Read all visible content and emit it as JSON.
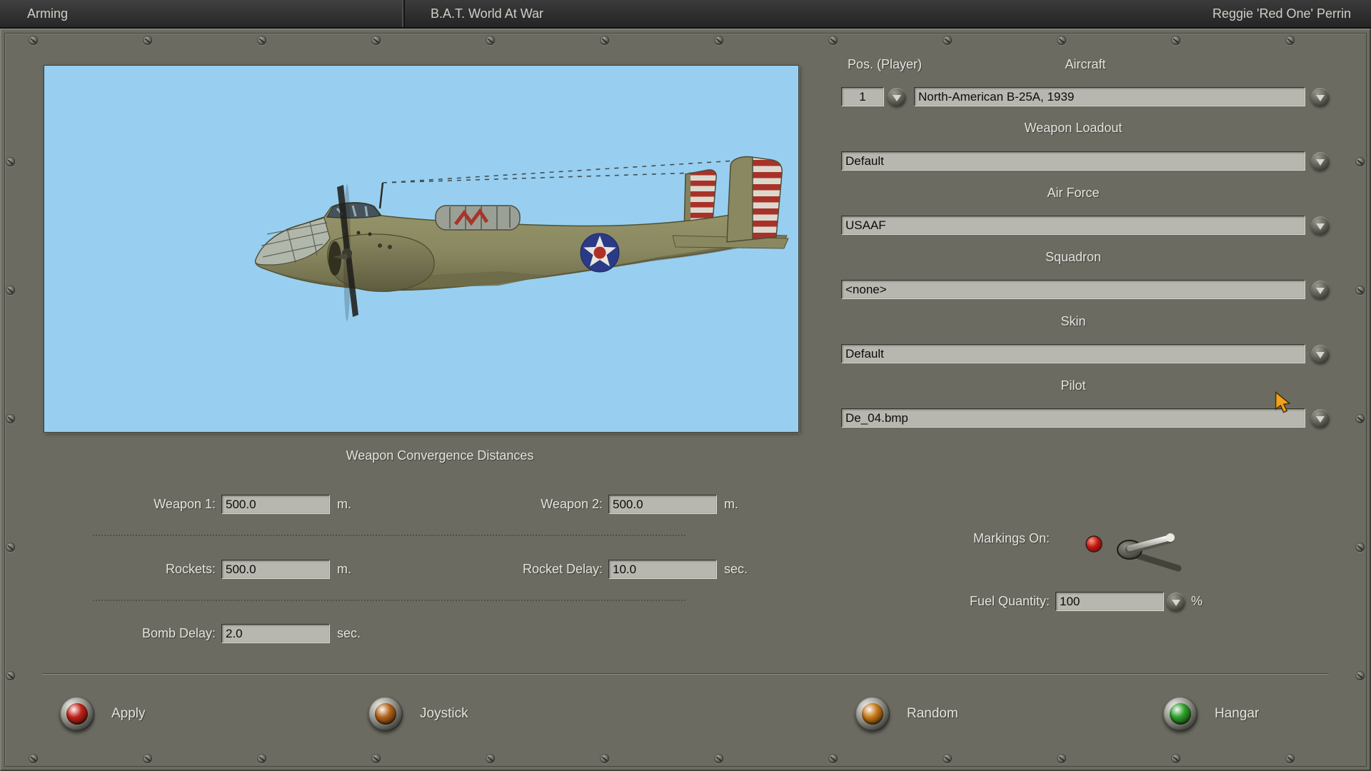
{
  "topbar": {
    "tab": "Arming",
    "title": "B.A.T. World At War",
    "player": "Reggie 'Red One' Perrin"
  },
  "form": {
    "pos": {
      "label": "Pos. (Player)",
      "value": "1"
    },
    "aircraft": {
      "label": "Aircraft",
      "value": "North-American B-25A, 1939"
    },
    "loadout": {
      "label": "Weapon Loadout",
      "value": "Default"
    },
    "airforce": {
      "label": "Air Force",
      "value": "USAAF"
    },
    "squadron": {
      "label": "Squadron",
      "value": "<none>"
    },
    "skin": {
      "label": "Skin",
      "value": "Default"
    },
    "pilot": {
      "label": "Pilot",
      "value": "De_04.bmp"
    }
  },
  "convergence": {
    "title": "Weapon Convergence Distances",
    "weapon1": {
      "label": "Weapon 1:",
      "value": "500.0",
      "unit": "m."
    },
    "weapon2": {
      "label": "Weapon 2:",
      "value": "500.0",
      "unit": "m."
    },
    "rockets": {
      "label": "Rockets:",
      "value": "500.0",
      "unit": "m."
    },
    "rocket_delay": {
      "label": "Rocket Delay:",
      "value": "10.0",
      "unit": "sec."
    },
    "bomb_delay": {
      "label": "Bomb Delay:",
      "value": "2.0",
      "unit": "sec."
    }
  },
  "markings": {
    "label": "Markings On:",
    "state": "on"
  },
  "fuel": {
    "label": "Fuel Quantity:",
    "value": "100",
    "unit": "%"
  },
  "actions": {
    "apply": {
      "label": "Apply",
      "led": "#c32017"
    },
    "joystick": {
      "label": "Joystick",
      "led": "#b56318"
    },
    "random": {
      "label": "Random",
      "led": "#c97a16"
    },
    "hangar": {
      "label": "Hangar",
      "led": "#2ba028"
    }
  },
  "colors": {
    "sky": "#98cff0",
    "cursor": "#f0a21e",
    "panel": "#6b6b62"
  }
}
